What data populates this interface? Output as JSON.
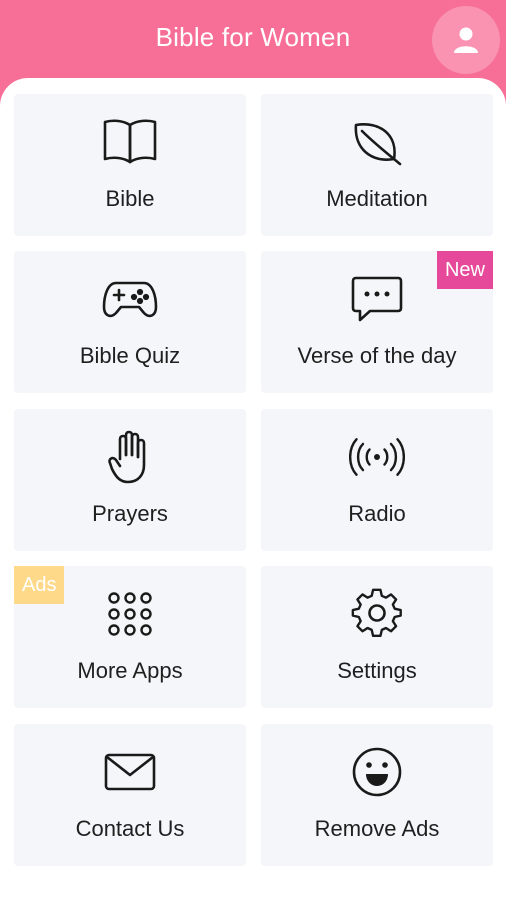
{
  "colors": {
    "header": "#f76f97",
    "tile": "#f4f6f9",
    "badge_new": "#e6499a",
    "badge_ads": "#ffd98a"
  },
  "header": {
    "title": "Bible for Women",
    "profile_icon": "user-icon"
  },
  "tiles": [
    {
      "label": "Bible",
      "icon": "book-icon"
    },
    {
      "label": "Meditation",
      "icon": "leaf-icon"
    },
    {
      "label": "Bible Quiz",
      "icon": "gamepad-icon"
    },
    {
      "label": "Verse of the day",
      "icon": "message-dots-icon",
      "badge": "New"
    },
    {
      "label": "Prayers",
      "icon": "hand-icon"
    },
    {
      "label": "Radio",
      "icon": "radio-signal-icon"
    },
    {
      "label": "More Apps",
      "icon": "grid-dots-icon",
      "badge": "Ads"
    },
    {
      "label": "Settings",
      "icon": "gear-icon"
    },
    {
      "label": "Contact Us",
      "icon": "mail-icon"
    },
    {
      "label": "Remove Ads",
      "icon": "smiley-icon"
    }
  ]
}
